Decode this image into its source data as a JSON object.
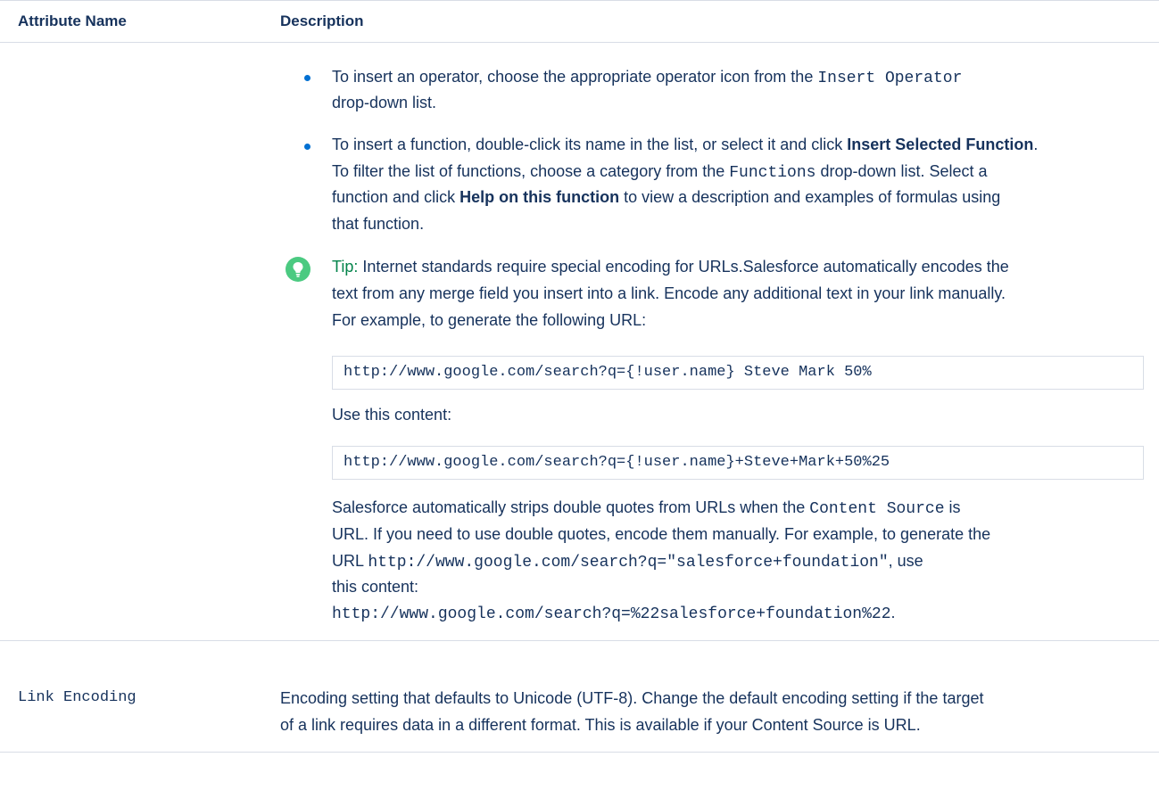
{
  "header": {
    "col_name": "Attribute Name",
    "col_desc": "Description"
  },
  "row1": {
    "bullet1": {
      "line1_pre": "To insert an operator, choose the appropriate operator icon from the",
      "line1_code": "Insert Operator",
      "line2": "drop-down list."
    },
    "bullet2": {
      "line1_pre": "To insert a function, double-click its name in the list, or select it and click",
      "line1_bold": "Insert Selected Function",
      "line1_post": ".",
      "line2_pre": "To filter the list of functions, choose a category from the",
      "line2_code": "Functions",
      "line2_post": "drop-down list. Select a",
      "line3_pre": "function and click",
      "line3_bold": "Help on this function",
      "line3_post": "to view a description and examples of formulas using",
      "line4": "that function."
    },
    "tip": {
      "label": "Tip:",
      "line1": "Internet standards require special encoding for URLs.Salesforce automatically encodes the",
      "line2": "text from any merge field you insert into a link. Encode any additional text in your link manually.",
      "line3": "For example, to generate the following URL:",
      "code1": "http://www.google.com/search?q={!user.name} Steve Mark 50%",
      "use_content": "Use this content:",
      "code2": "http://www.google.com/search?q={!user.name}+Steve+Mark+50%25",
      "p_line1_pre": "Salesforce automatically strips double quotes from URLs when the",
      "p_line1_code": "Content Source",
      "p_line1_post": "is",
      "p_line2": "URL. If you need to use double quotes, encode them manually. For example, to generate the",
      "p_line3_pre": "URL",
      "p_line3_code": "http://www.google.com/search?q=\"salesforce+foundation\"",
      "p_line3_post": ", use",
      "p_line4": "this content:",
      "p_line5_code": "http://www.google.com/search?q=%22salesforce+foundation%22",
      "p_line5_post": "."
    }
  },
  "row2": {
    "name": "Link Encoding",
    "desc_line1": "Encoding setting that defaults to Unicode (UTF-8). Change the default encoding setting if the target",
    "desc_line2": "of a link requires data in a different format. This is available if your Content Source is URL."
  },
  "colors": {
    "text": "#16325c",
    "bullet": "#0070d2",
    "tip_icon": "#4bca81",
    "tip_label": "#04844b",
    "border": "#d8dde6"
  }
}
